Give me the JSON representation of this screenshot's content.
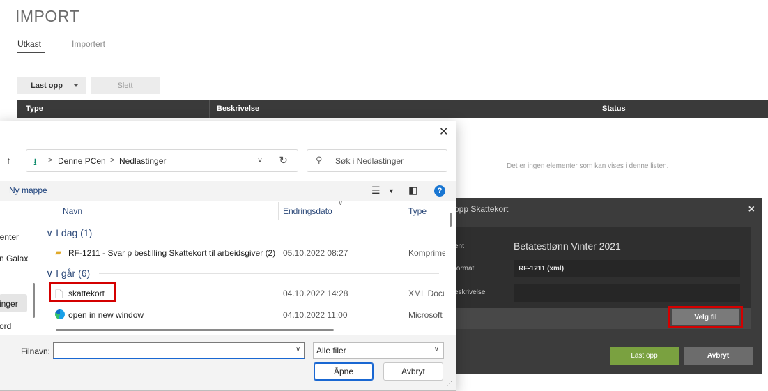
{
  "app": {
    "title": "IMPORT",
    "tabs": [
      {
        "label": "Utkast",
        "active": true
      },
      {
        "label": "Importert",
        "active": false
      }
    ],
    "toolbar": {
      "upload_label": "Last opp",
      "delete_label": "Slett"
    },
    "table": {
      "columns": [
        "Type",
        "Beskrivelse",
        "Status"
      ],
      "empty_message": "Det er ingen elementer som kan vises i denne listen."
    }
  },
  "modal": {
    "title": "opp Skattekort",
    "close_icon": "×",
    "fields": [
      {
        "label": "ent",
        "value": "Betatestlønn Vinter 2021"
      },
      {
        "label": "format",
        "value": "RF-1211 (xml)"
      },
      {
        "label": "eskrivelse",
        "value": ""
      }
    ],
    "choose_file_label": "Velg fil",
    "upload_label": "Last opp",
    "cancel_label": "Avbryt",
    "highlight_color": "#d40000",
    "upload_color": "#7aa140"
  },
  "file_dialog": {
    "close_icon": "✕",
    "up_icon": "↑",
    "breadcrumb": [
      "Denne PCen",
      "Nedlastinger"
    ],
    "breadcrumb_sep": ">",
    "search_placeholder": "Søk i Nedlastinger",
    "new_folder_label": "Ny mappe",
    "help_icon": "?",
    "nav_items": [
      "enter",
      "n Galax",
      "inger",
      "ord"
    ],
    "columns": [
      "Navn",
      "Endringsdato",
      "Type"
    ],
    "groups": [
      {
        "header": "I dag (1)",
        "chevron": "∨",
        "files": [
          {
            "name": "RF-1211 - Svar p bestilling Skattekort til arbeidsgiver (2)",
            "date": "05.10.2022 08:27",
            "type": "Komprimert",
            "icon": "zip-folder-icon"
          }
        ]
      },
      {
        "header": "I går (6)",
        "chevron": "∨",
        "files": [
          {
            "name": "skattekort",
            "date": "04.10.2022 14:28",
            "type": "XML Document",
            "icon": "xml-file-icon"
          },
          {
            "name": "open in new window",
            "date": "04.10.2022 11:00",
            "type": "Microsoft",
            "icon": "edge-icon"
          }
        ]
      }
    ],
    "filename_label": "Filnavn:",
    "filename_value": "",
    "filter_value": "Alle filer",
    "open_label": "Åpne",
    "cancel_label": "Avbryt"
  }
}
